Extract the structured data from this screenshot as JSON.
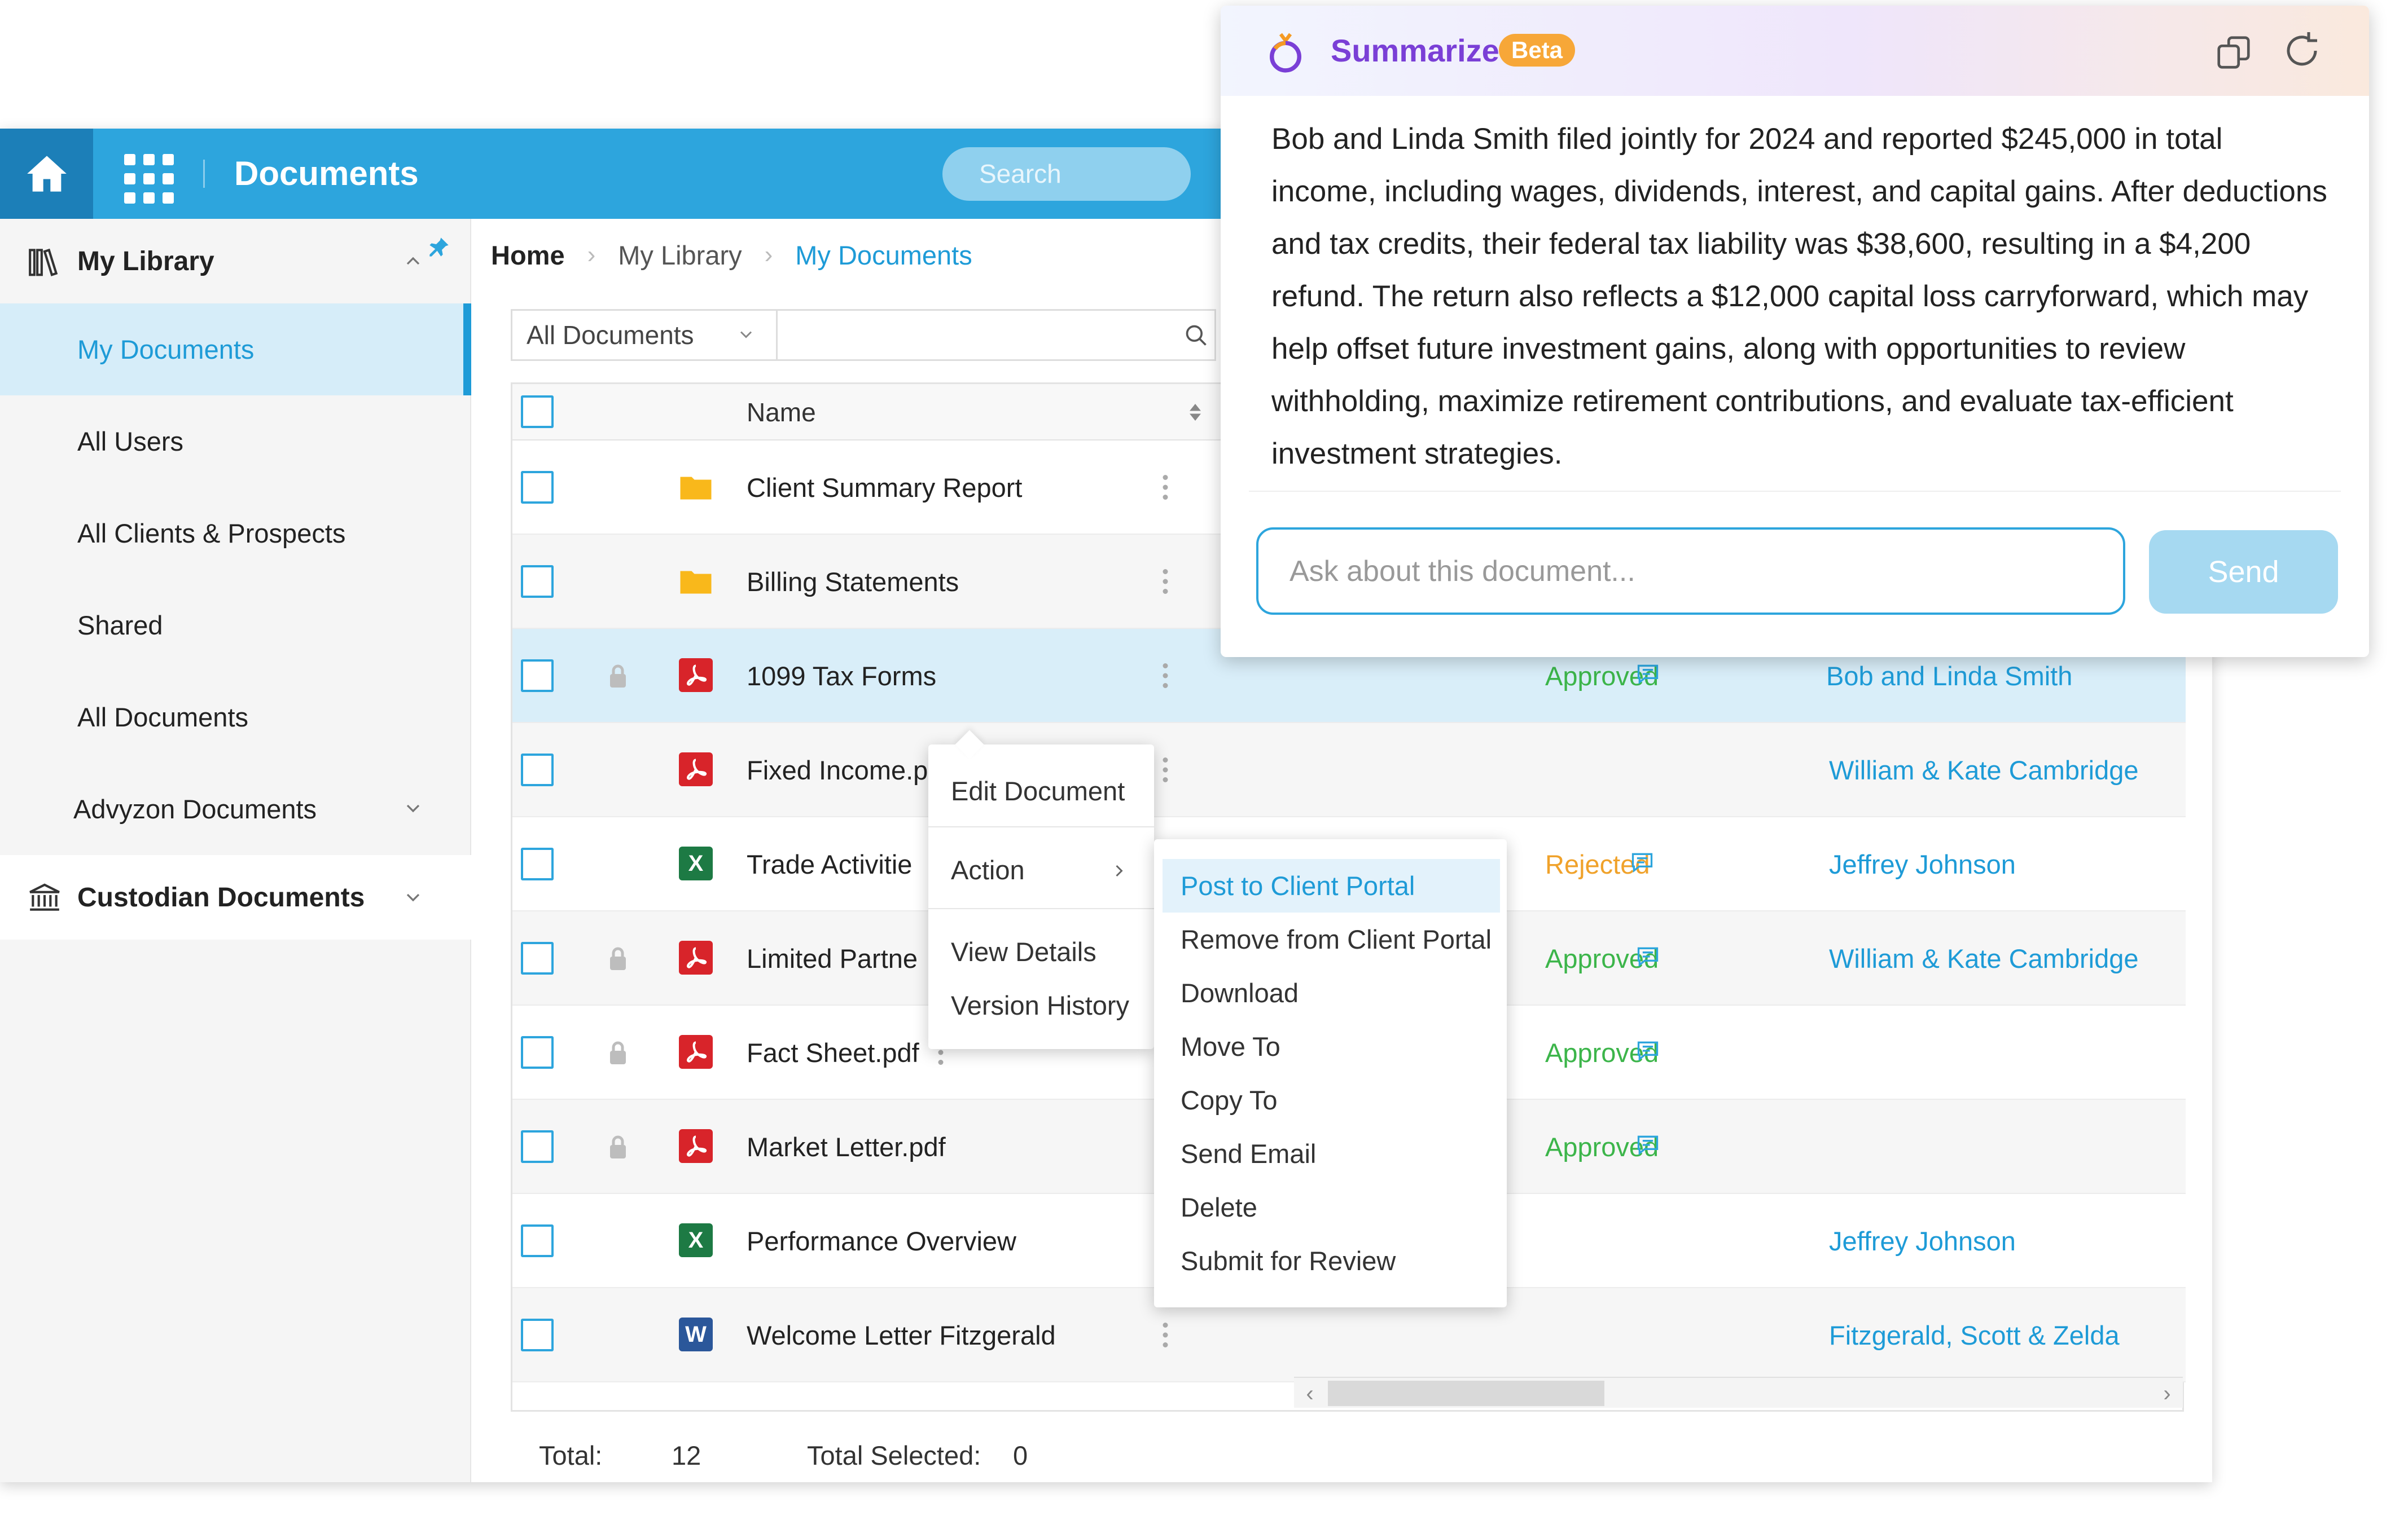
{
  "topbar": {
    "title": "Documents",
    "search_placeholder": "Search"
  },
  "sidebar": {
    "my_library": "My Library",
    "items": [
      {
        "label": "My Documents",
        "active": true
      },
      {
        "label": "All Users"
      },
      {
        "label": "All Clients & Prospects"
      },
      {
        "label": "Shared"
      },
      {
        "label": "All Documents"
      },
      {
        "label": "Advyzon Documents"
      }
    ],
    "custodian": "Custodian Documents"
  },
  "breadcrumb": {
    "home": "Home",
    "library": "My Library",
    "current": "My Documents"
  },
  "filter": {
    "selected": "All Documents",
    "value": ""
  },
  "grid": {
    "name_header": "Name",
    "rows": [
      {
        "name": "Client Summary Report",
        "type": "folder",
        "locked": false,
        "status": "",
        "client": ""
      },
      {
        "name": "Billing Statements",
        "type": "folder",
        "locked": false,
        "status": "",
        "client": ""
      },
      {
        "name": "1099 Tax Forms",
        "type": "pdf",
        "locked": true,
        "status": "Approved",
        "client": "Bob and Linda Smith"
      },
      {
        "name": "Fixed Income.p",
        "type": "pdf",
        "locked": false,
        "status": "",
        "client": "William & Kate Cambridge"
      },
      {
        "name": "Trade Activitie",
        "type": "xls",
        "locked": false,
        "status": "Rejected",
        "client": "Jeffrey Johnson"
      },
      {
        "name": "Limited Partne",
        "type": "pdf",
        "locked": true,
        "status": "Approved",
        "client": "William & Kate Cambridge"
      },
      {
        "name": "Fact Sheet.pdf",
        "type": "pdf",
        "locked": true,
        "status": "Approved",
        "client": ""
      },
      {
        "name": "Market  Letter.pdf",
        "type": "pdf",
        "locked": true,
        "status": "Approved",
        "client": ""
      },
      {
        "name": "Performance Overview",
        "type": "xls",
        "locked": false,
        "status": "",
        "client": "Jeffrey Johnson"
      },
      {
        "name": "Welcome Letter  Fitzgerald",
        "type": "doc",
        "locked": false,
        "status": "",
        "client": "Fitzgerald, Scott & Zelda"
      }
    ],
    "icon_letters": {
      "xls": "X",
      "doc": "W"
    }
  },
  "footer": {
    "total_label": "Total:",
    "total_value": "12",
    "selected_label": "Total Selected:",
    "selected_value": "0"
  },
  "doc_menu": {
    "edit": "Edit Document",
    "action": "Action",
    "view": "View Details",
    "history": "Version History"
  },
  "action_menu": {
    "items": [
      "Post to Client Portal",
      "Remove from Client Portal",
      "Download",
      "Move To",
      "Copy To",
      "Send Email",
      "Delete",
      "Submit for Review"
    ]
  },
  "summarize": {
    "title": "Summarize",
    "badge": "Beta",
    "text": "Bob and Linda Smith filed jointly for 2024 and reported $245,000 in total income, including wages, dividends, interest, and capital gains. After deductions and tax credits, their federal tax liability was $38,600, resulting in a $4,200 refund. The return also reflects a $12,000 capital loss carryforward, which may help offset future investment gains, along with opportunities to review withholding, maximize retirement contributions, and evaluate tax-efficient investment strategies.",
    "placeholder": "Ask about this document...",
    "send": "Send"
  },
  "colors": {
    "accent": "#2da5dd",
    "approved": "#3cb54a",
    "rejected": "#f0a22b",
    "pdf": "#d8242a",
    "xls": "#1d7a44",
    "doc": "#2b579a",
    "folder": "#f9b81b",
    "summarize_title": "#7a3fd6",
    "beta_badge": "#f7a738"
  }
}
